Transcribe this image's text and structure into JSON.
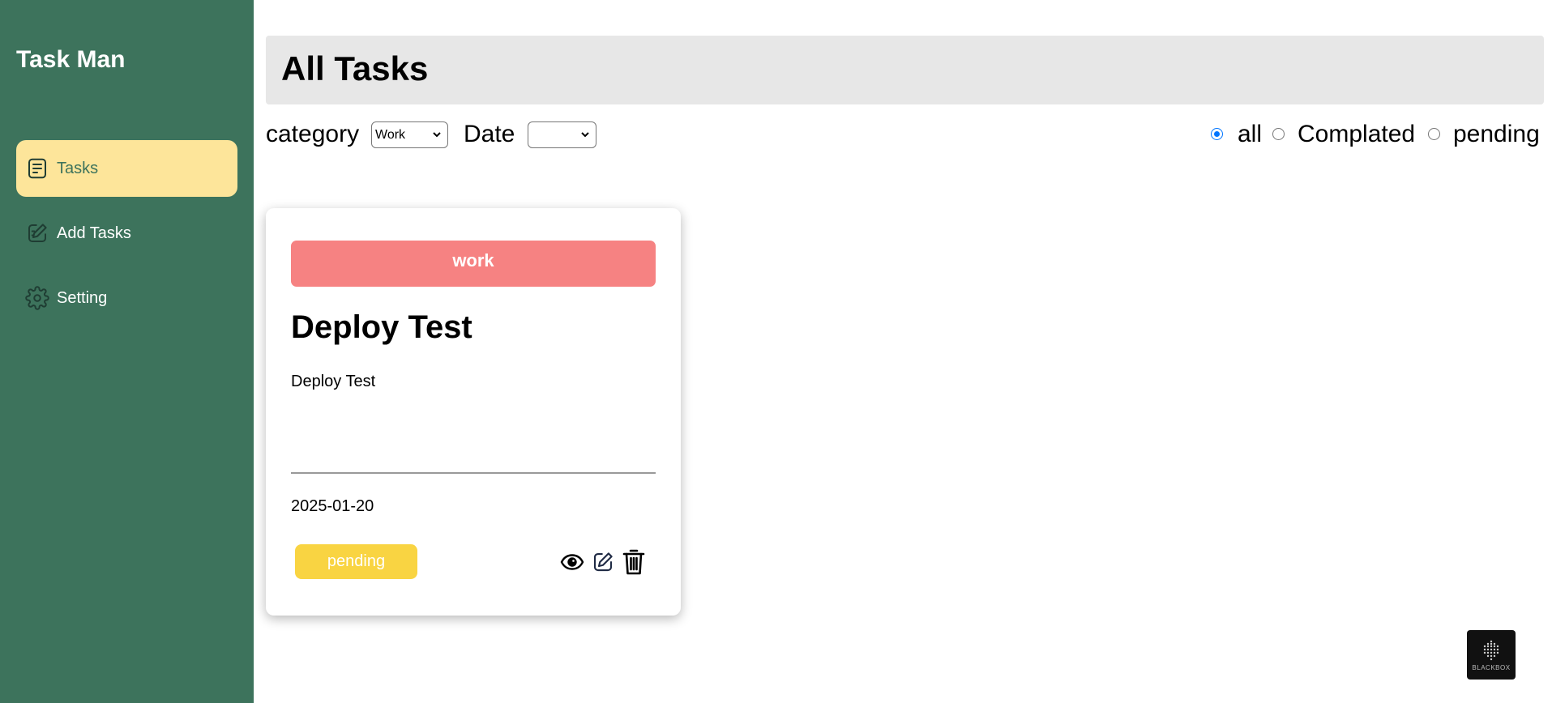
{
  "app": {
    "title": "Task Man"
  },
  "sidebar": {
    "items": [
      {
        "label": "Tasks",
        "icon": "document-icon",
        "active": true
      },
      {
        "label": "Add Tasks",
        "icon": "edit-square-icon",
        "active": false
      },
      {
        "label": "Setting",
        "icon": "gear-icon",
        "active": false
      }
    ]
  },
  "header": {
    "title": "All Tasks"
  },
  "filters": {
    "category_label": "category",
    "category_value": "Work",
    "date_label": "Date",
    "date_value": "",
    "status_options": [
      {
        "label": "all",
        "checked": true
      },
      {
        "label": "Complated",
        "checked": false
      },
      {
        "label": "pending",
        "checked": false
      }
    ]
  },
  "tasks": [
    {
      "category": "work",
      "title": "Deploy Test",
      "description": "Deploy Test",
      "date": "2025-01-20",
      "status": "pending",
      "actions": [
        "eye-icon",
        "edit-icon",
        "trash-icon"
      ]
    }
  ],
  "badge": {
    "text": "BLACKBOX"
  },
  "colors": {
    "sidebar_bg": "#3d735c",
    "active_nav_bg": "#fde59a",
    "header_bg": "#e7e7e7",
    "category_banner": "#f68282",
    "status_pending": "#f9d442",
    "radio_accent": "#0075ff"
  }
}
